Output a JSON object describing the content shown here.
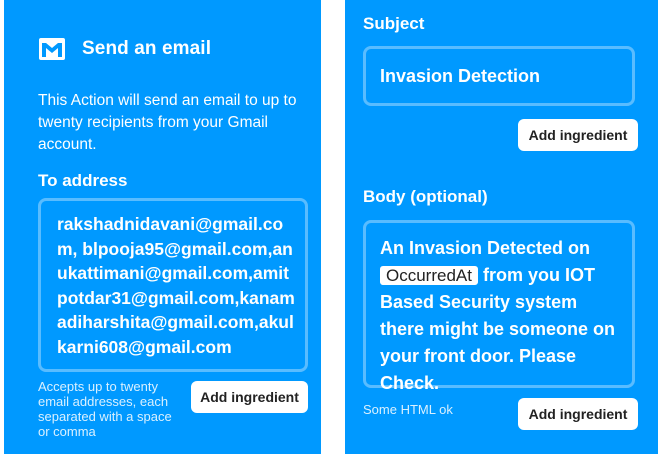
{
  "action": {
    "title": "Send an email",
    "icon": "gmail-icon",
    "description": "This Action will send an email to up to twenty recipients from your Gmail account."
  },
  "to_address": {
    "label": "To address",
    "value": "rakshadnidavani@gmail.com, blpooja95@gmail.com,anukattimani@gmail.com,amitpotdar31@gmail.com,kanamadiharshita@gmail.com,akulkarni608@gmail.com",
    "hint": "Accepts up to twenty email addresses, each separated with a space or comma",
    "button_label": "Add ingredient"
  },
  "subject": {
    "label": "Subject",
    "value": "Invasion Detection",
    "button_label": "Add ingredient"
  },
  "body": {
    "label": "Body (optional)",
    "text_before": "An Invasion Detected on",
    "ingredient": "OccurredAt",
    "text_after": "from you IOT Based Security system there might be someone on your front door. Please Check.",
    "hint": "Some HTML ok",
    "button_label": "Add ingredient"
  },
  "colors": {
    "panel_bg": "#0099ff",
    "text": "#ffffff",
    "button_bg": "#ffffff",
    "button_text": "#222222"
  }
}
